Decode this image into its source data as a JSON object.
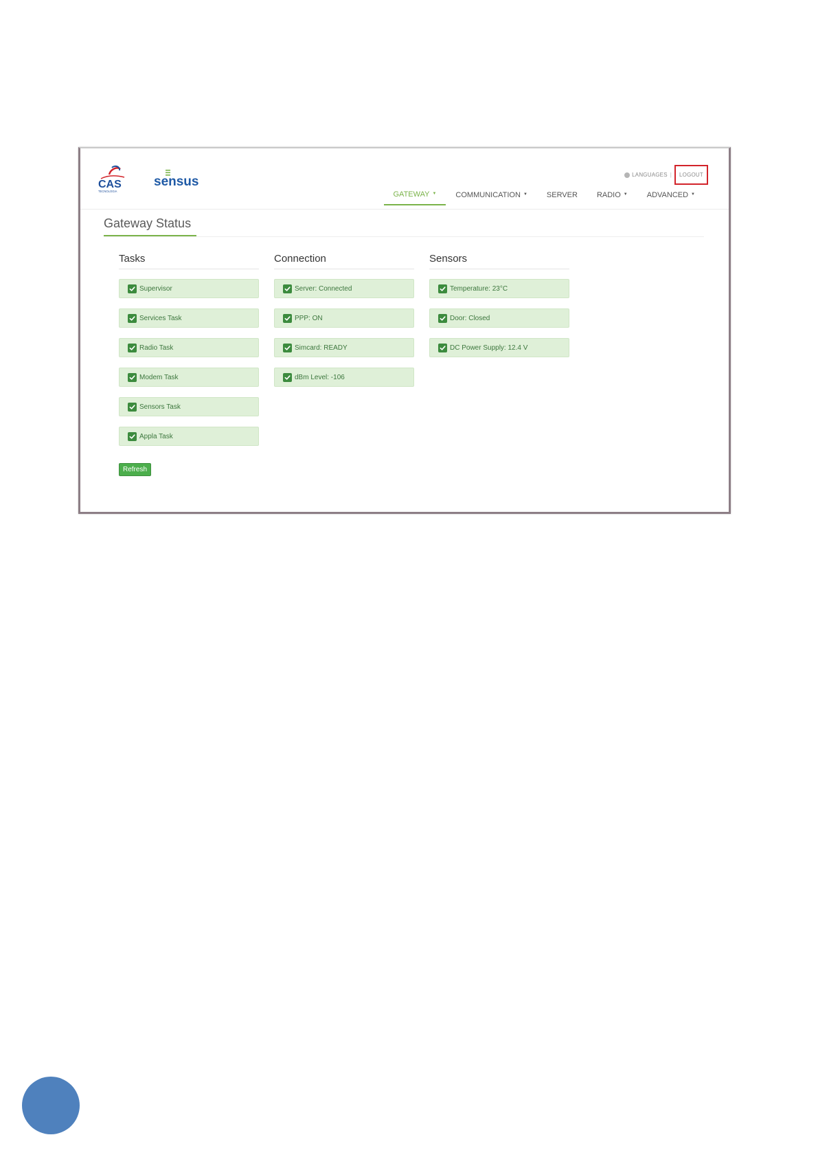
{
  "brand": {
    "cas_text": "CAS",
    "cas_subtext": "TECNOLOGIA",
    "sensus_text": "sensus"
  },
  "top_links": {
    "languages": "LANGUAGES",
    "separator": "|",
    "logout": "LOGOUT"
  },
  "nav": {
    "items": [
      {
        "label": "GATEWAY",
        "has_caret": true,
        "active": true
      },
      {
        "label": "COMMUNICATION",
        "has_caret": true,
        "active": false
      },
      {
        "label": "SERVER",
        "has_caret": false,
        "active": false
      },
      {
        "label": "RADIO",
        "has_caret": true,
        "active": false
      },
      {
        "label": "ADVANCED",
        "has_caret": true,
        "active": false
      }
    ],
    "caret_glyph": "▼"
  },
  "page_title": "Gateway Status",
  "columns": {
    "tasks": {
      "heading": "Tasks",
      "items": [
        "Supervisor",
        "Services Task",
        "Radio Task",
        "Modem Task",
        "Sensors Task",
        "Appla Task"
      ]
    },
    "connection": {
      "heading": "Connection",
      "items": [
        "Server: Connected",
        "PPP: ON",
        "Simcard: READY",
        "dBm Level: -106"
      ]
    },
    "sensors": {
      "heading": "Sensors",
      "items": [
        "Temperature: 23°C",
        "Door: Closed",
        "DC Power Supply: 12.4 V"
      ]
    }
  },
  "refresh_label": "Refresh",
  "colors": {
    "accent_green": "#7ab349",
    "status_bg": "#dff0d8",
    "status_text": "#3c763d",
    "check_green": "#3c8b3e",
    "button_green": "#4cae4c",
    "logout_highlight": "#d2232a",
    "cas_blue": "#1e4f9c",
    "cas_red": "#d2232a",
    "sensus_blue": "#1f5aa6",
    "page_marker_blue": "#4f81bd"
  }
}
